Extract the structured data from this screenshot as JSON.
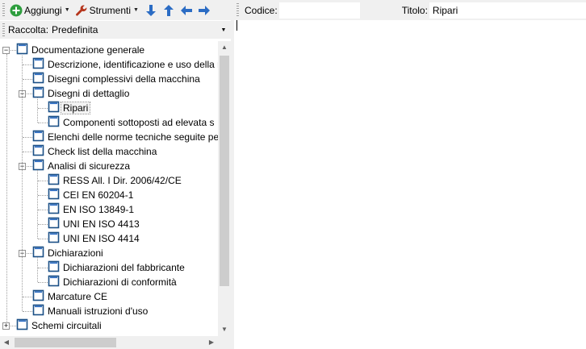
{
  "toolbar": {
    "add_label": "Aggiungi",
    "tools_label": "Strumenti",
    "add_icon": "plus-circle-icon",
    "tools_icon": "wrench-icon",
    "move_down_icon": "arrow-down-icon",
    "move_up_icon": "arrow-up-icon",
    "outdent_icon": "arrow-left-icon",
    "indent_icon": "arrow-right-icon"
  },
  "collection": {
    "label": "Raccolta:",
    "value": "Predefinita"
  },
  "tree": {
    "items": [
      {
        "label": "Documentazione generale",
        "level": 0,
        "expander": "minus",
        "selected": false
      },
      {
        "label": "Descrizione, identificazione e uso della m",
        "level": 1,
        "expander": "",
        "selected": false
      },
      {
        "label": "Disegni complessivi della macchina",
        "level": 1,
        "expander": "",
        "selected": false
      },
      {
        "label": "Disegni di dettaglio",
        "level": 1,
        "expander": "minus",
        "selected": false
      },
      {
        "label": "Ripari",
        "level": 2,
        "expander": "",
        "selected": true
      },
      {
        "label": "Componenti sottoposti ad elevata s",
        "level": 2,
        "expander": "",
        "selected": false
      },
      {
        "label": "Elenchi delle norme tecniche seguite pe",
        "level": 1,
        "expander": "",
        "selected": false
      },
      {
        "label": "Check list della macchina",
        "level": 1,
        "expander": "",
        "selected": false
      },
      {
        "label": "Analisi di sicurezza",
        "level": 1,
        "expander": "minus",
        "selected": false
      },
      {
        "label": "RESS All. I Dir. 2006/42/CE",
        "level": 2,
        "expander": "",
        "selected": false
      },
      {
        "label": "CEI EN 60204-1",
        "level": 2,
        "expander": "",
        "selected": false
      },
      {
        "label": "EN ISO 13849-1",
        "level": 2,
        "expander": "",
        "selected": false
      },
      {
        "label": "UNI EN ISO 4413",
        "level": 2,
        "expander": "",
        "selected": false
      },
      {
        "label": "UNI EN ISO 4414",
        "level": 2,
        "expander": "",
        "selected": false
      },
      {
        "label": "Dichiarazioni",
        "level": 1,
        "expander": "minus",
        "selected": false
      },
      {
        "label": "Dichiarazioni del fabbricante",
        "level": 2,
        "expander": "",
        "selected": false
      },
      {
        "label": "Dichiarazioni di conformità",
        "level": 2,
        "expander": "",
        "selected": false
      },
      {
        "label": "Marcature CE",
        "level": 1,
        "expander": "",
        "selected": false
      },
      {
        "label": "Manuali istruzioni d'uso",
        "level": 1,
        "expander": "",
        "selected": false
      },
      {
        "label": "Schemi circuitali",
        "level": 0,
        "expander": "plus",
        "selected": false
      }
    ]
  },
  "detail": {
    "code_label": "Codice:",
    "code_value": "",
    "title_label": "Titolo:",
    "title_value": "Ripari"
  },
  "colors": {
    "accent_green": "#2e9e3e",
    "arrow_blue": "#2b6cc4",
    "wrench_red": "#b5351c",
    "panel_gray": "#f0f0f0"
  }
}
